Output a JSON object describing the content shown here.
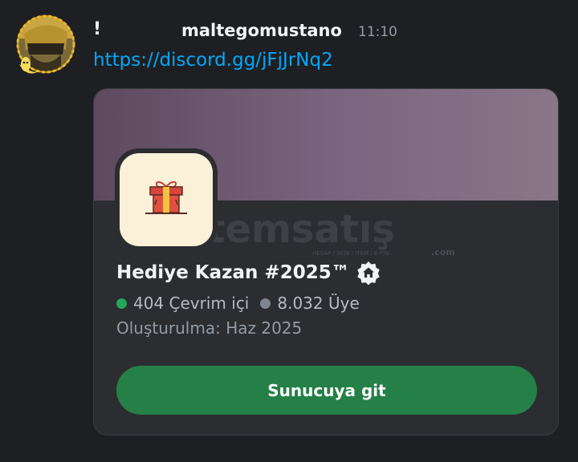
{
  "message": {
    "prefix": "!",
    "username": "maltegomustano",
    "timestamp": "11:10",
    "link_text": "https://discord.gg/jFjJrNq2"
  },
  "invite": {
    "server_name": "Hediye Kazan #2025™",
    "online_count": "404 Çevrim içi",
    "member_count": "8.032 Üye",
    "created": "Oluşturulma: Haz 2025",
    "join_label": "Sunucuya git",
    "watermark_text": "itemsatış",
    "watermark_subtext": "HESAP / SKIN / ITEM / E-PIN",
    "watermark_suffix": ".com"
  },
  "colors": {
    "background": "#1e1f22",
    "card": "#2b2d31",
    "link": "#00a8fc",
    "join_button": "#248046",
    "online_dot": "#23a55a",
    "member_dot": "#80848e",
    "banner": "#7a6680"
  },
  "icons": {
    "avatar": "user-avatar",
    "server": "gift-icon",
    "badge": "verified-home-badge"
  }
}
